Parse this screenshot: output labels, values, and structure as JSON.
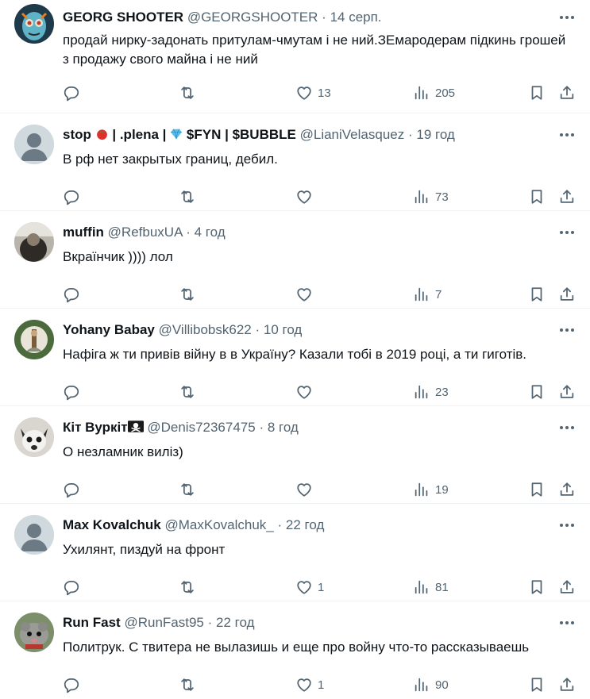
{
  "colors": {
    "text": "#0f1419",
    "muted": "#536471",
    "divider": "#eff3f4"
  },
  "icons": {
    "reply": "speech-bubble-icon",
    "retweet": "retweet-arrows-icon",
    "like": "heart-icon",
    "views": "bar-chart-icon",
    "bookmark": "bookmark-icon",
    "share": "share-upload-icon",
    "more": "three-dots-icon"
  },
  "tweets": [
    {
      "name": "GEORG SHOOTER",
      "handle": "@GEORGSHOOTER",
      "time": "14 серп.",
      "text": "продай нирку-задонать притулам-чмутам і не ний.ЗЕмародерам підкинь грошей з продажу свого майна і не ний",
      "likes": "13",
      "views": "205"
    },
    {
      "name_parts": [
        "stop",
        "| .plena |",
        "$FYN | $BUBBLE"
      ],
      "name_emojis": [
        "tomato",
        "gem"
      ],
      "handle": "@LianiVelasquez",
      "time": "19 год",
      "text": "В рф нет закрытых границ, дебил.",
      "likes": "",
      "views": "73"
    },
    {
      "name": "muffin",
      "handle": "@RefbuxUA",
      "time": "4 год",
      "text": "Вкраїнчик )))) лол",
      "likes": "",
      "views": "7"
    },
    {
      "name": "Yohany Babay",
      "handle": "@Villibobsk622",
      "time": "10 год",
      "text": "Нафіга ж ти привів війну в в Україну? Казали тобі в 2019 році, а ти гиготів.",
      "likes": "",
      "views": "23"
    },
    {
      "name": "Кіт Вуркіт",
      "name_emoji": "skull-crossbones-flag",
      "handle": "@Denis72367475",
      "time": "8 год",
      "text": "О незламник виліз)",
      "likes": "",
      "views": "19"
    },
    {
      "name": "Max Kovalchuk",
      "handle": "@MaxKovalchuk_",
      "time": "22 год",
      "text": "Ухилянт, пиздуй на фронт",
      "likes": "1",
      "views": "81"
    },
    {
      "name": "Run Fast",
      "handle": "@RunFast95",
      "time": "22 год",
      "text": "Политрук. С твитера не вылазишь и еще про войну что-то рассказываешь",
      "likes": "1",
      "views": "90"
    }
  ]
}
